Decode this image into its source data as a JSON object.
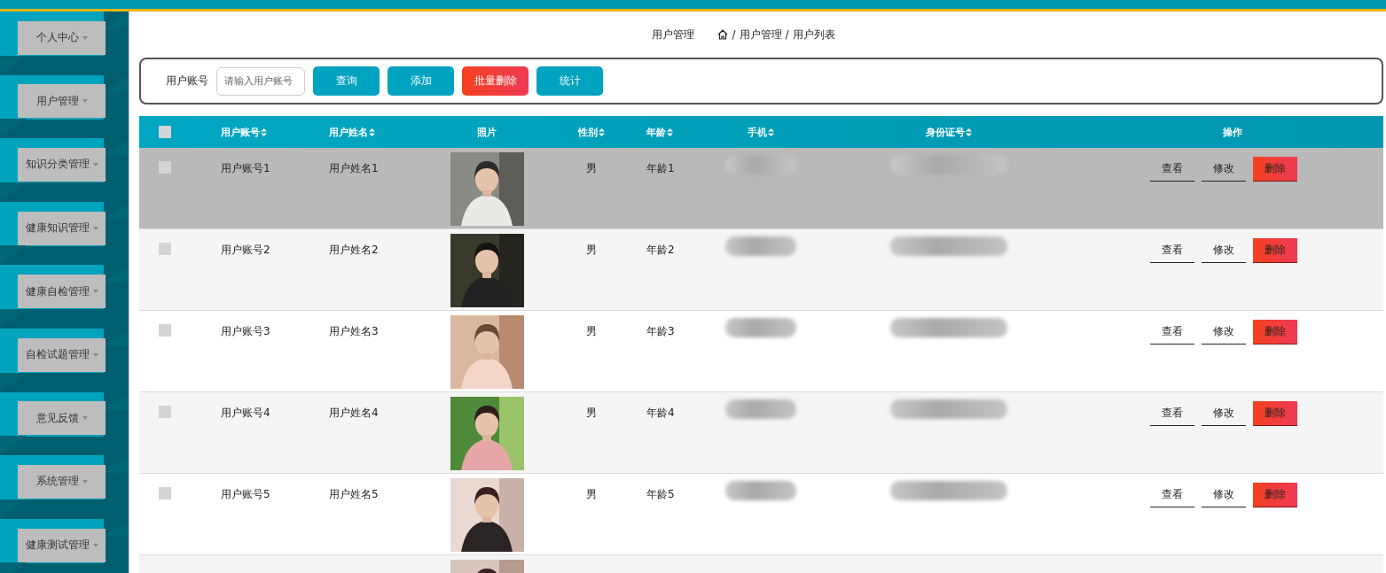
{
  "sidebar": {
    "items": [
      {
        "label": "个人中心",
        "expanded": false
      },
      {
        "label": "用户管理",
        "expanded": false
      },
      {
        "label": "知识分类管理",
        "expanded": false
      },
      {
        "label": "健康知识管理",
        "expanded": false
      },
      {
        "label": "健康自检管理",
        "expanded": false
      },
      {
        "label": "自检试题管理",
        "expanded": false
      },
      {
        "label": "意见反馈",
        "expanded": false
      },
      {
        "label": "系统管理",
        "expanded": false
      },
      {
        "label": "健康测试管理",
        "expanded": false
      }
    ]
  },
  "page_title": "用户管理",
  "breadcrumb": [
    {
      "separator": "/",
      "label": "用户管理"
    },
    {
      "separator": "/",
      "label": "用户列表"
    }
  ],
  "search": {
    "label": "用户账号",
    "placeholder": "请输入用户账号",
    "buttons": [
      {
        "label": "查询",
        "kind": "primary"
      },
      {
        "label": "添加",
        "kind": "primary"
      },
      {
        "label": "批量删除",
        "kind": "danger"
      },
      {
        "label": "统计",
        "kind": "primary"
      }
    ]
  },
  "table": {
    "select_all": {
      "checked": false
    },
    "columns": [
      {
        "label": "用户账号",
        "sortable": true
      },
      {
        "label": "用户姓名",
        "sortable": true
      },
      {
        "label": "照片",
        "sortable": false
      },
      {
        "label": "性别",
        "sortable": true
      },
      {
        "label": "年龄",
        "sortable": true
      },
      {
        "label": "手机",
        "sortable": true
      },
      {
        "label": "身份证号",
        "sortable": true
      },
      {
        "label": "操作",
        "sortable": false
      }
    ],
    "rows": [
      {
        "checked": false,
        "highlighted": true,
        "account": "用户账号1",
        "name": "用户姓名1",
        "photo": {
          "kind": "picture"
        },
        "gender": "男",
        "age": "年龄1",
        "actions": [
          {
            "label": "查看",
            "kind": "plain"
          },
          {
            "label": "修改",
            "kind": "plain"
          },
          {
            "label": "删除",
            "kind": "danger"
          }
        ]
      },
      {
        "checked": false,
        "highlighted": false,
        "account": "用户账号2",
        "name": "用户姓名2",
        "photo": {
          "kind": "picture"
        },
        "gender": "男",
        "age": "年龄2",
        "actions": [
          {
            "label": "查看",
            "kind": "plain"
          },
          {
            "label": "修改",
            "kind": "plain"
          },
          {
            "label": "删除",
            "kind": "danger"
          }
        ]
      },
      {
        "checked": false,
        "highlighted": false,
        "account": "用户账号3",
        "name": "用户姓名3",
        "photo": {
          "kind": "picture"
        },
        "gender": "男",
        "age": "年龄3",
        "actions": [
          {
            "label": "查看",
            "kind": "plain"
          },
          {
            "label": "修改",
            "kind": "plain"
          },
          {
            "label": "删除",
            "kind": "danger"
          }
        ]
      },
      {
        "checked": false,
        "highlighted": false,
        "account": "用户账号4",
        "name": "用户姓名4",
        "photo": {
          "kind": "picture"
        },
        "gender": "男",
        "age": "年龄4",
        "actions": [
          {
            "label": "查看",
            "kind": "plain"
          },
          {
            "label": "修改",
            "kind": "plain"
          },
          {
            "label": "删除",
            "kind": "danger"
          }
        ]
      },
      {
        "checked": false,
        "highlighted": false,
        "account": "用户账号5",
        "name": "用户姓名5",
        "photo": {
          "kind": "picture"
        },
        "gender": "男",
        "age": "年龄5",
        "actions": [
          {
            "label": "查看",
            "kind": "plain"
          },
          {
            "label": "修改",
            "kind": "plain"
          },
          {
            "label": "删除",
            "kind": "danger"
          }
        ]
      }
    ],
    "cut_row": {
      "photo": {
        "kind": "picture"
      }
    }
  }
}
